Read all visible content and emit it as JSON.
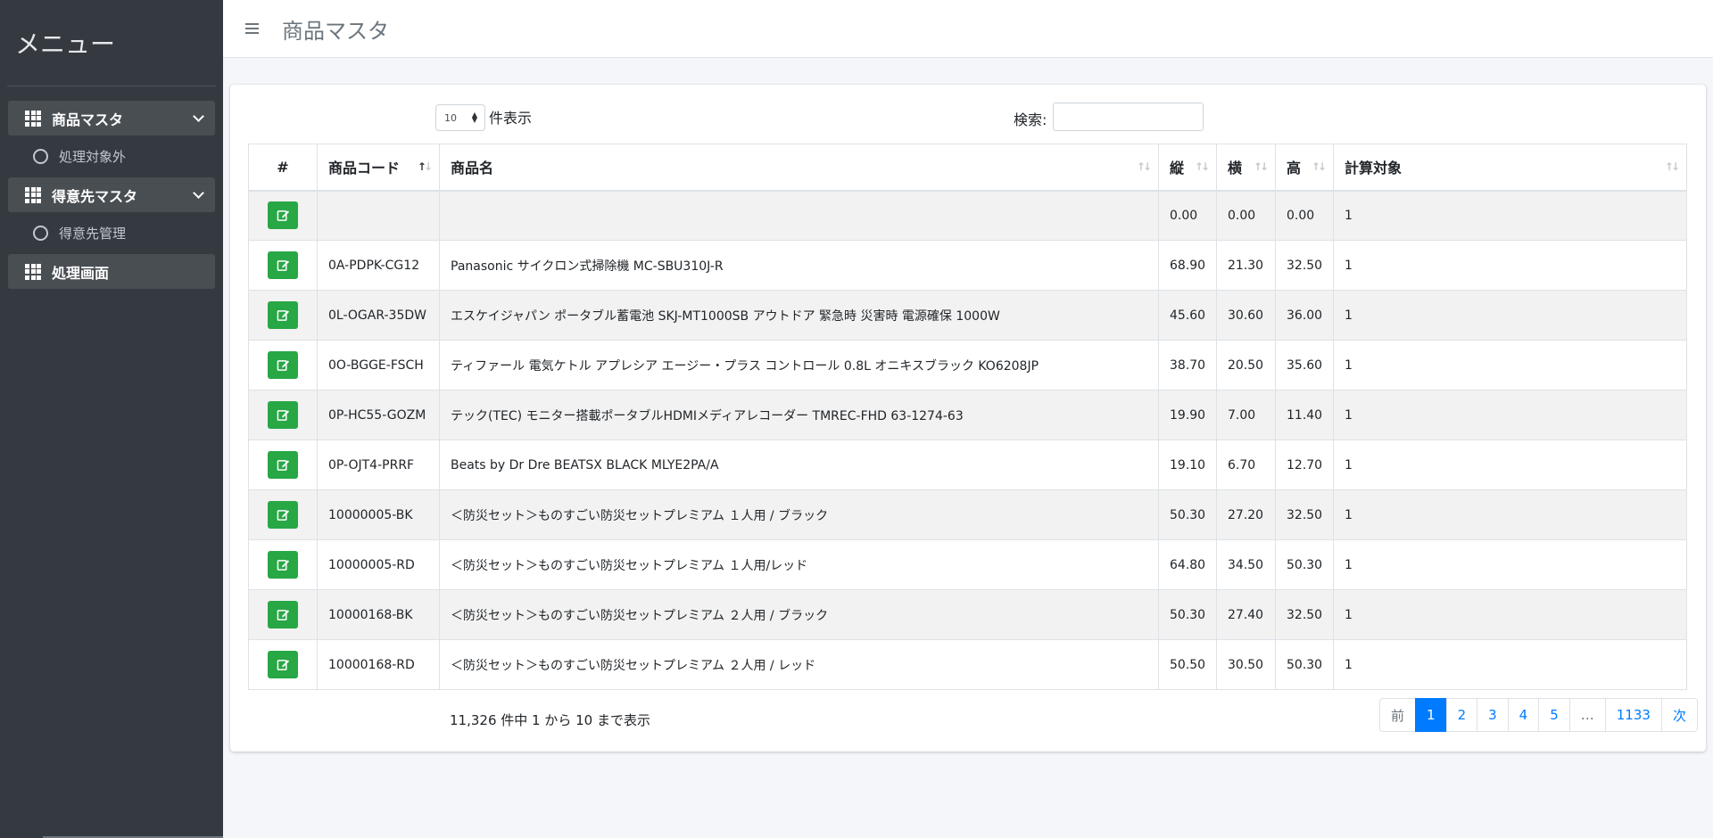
{
  "sidebar": {
    "brand": "メニュー",
    "items": [
      {
        "label": "商品マスタ",
        "type": "group"
      },
      {
        "label": "処理対象外",
        "type": "sub"
      },
      {
        "label": "得意先マスタ",
        "type": "group"
      },
      {
        "label": "得意先管理",
        "type": "sub"
      },
      {
        "label": "処理画面",
        "type": "group"
      }
    ]
  },
  "header": {
    "title": "商品マスタ",
    "menu_icon": "hamburger-icon"
  },
  "controls": {
    "length_value": "10",
    "length_label": "件表示",
    "search_label": "検索:",
    "search_value": ""
  },
  "table": {
    "columns": [
      "#",
      "商品コード",
      "商品名",
      "縦",
      "横",
      "高",
      "計算対象"
    ],
    "rows": [
      {
        "code": "",
        "name": "",
        "h": "0.00",
        "w": "0.00",
        "d": "0.00",
        "calc": "1"
      },
      {
        "code": "0A-PDPK-CG12",
        "name": "Panasonic サイクロン式掃除機 MC-SBU310J-R",
        "h": "68.90",
        "w": "21.30",
        "d": "32.50",
        "calc": "1"
      },
      {
        "code": "0L-OGAR-35DW",
        "name": "エスケイジャパン ポータブル蓄電池 SKJ-MT1000SB アウトドア 緊急時 災害時 電源確保 1000W",
        "h": "45.60",
        "w": "30.60",
        "d": "36.00",
        "calc": "1"
      },
      {
        "code": "0O-BGGE-FSCH",
        "name": "ティファール 電気ケトル アプレシア エージー・プラス コントロール 0.8L オニキスブラック KO6208JP",
        "h": "38.70",
        "w": "20.50",
        "d": "35.60",
        "calc": "1"
      },
      {
        "code": "0P-HC55-GOZM",
        "name": "テック(TEC) モニター搭載ポータブルHDMIメディアレコーダー TMREC-FHD 63-1274-63",
        "h": "19.90",
        "w": "7.00",
        "d": "11.40",
        "calc": "1"
      },
      {
        "code": "0P-OJT4-PRRF",
        "name": "Beats by Dr Dre BEATSX BLACK MLYE2PA/A",
        "h": "19.10",
        "w": "6.70",
        "d": "12.70",
        "calc": "1"
      },
      {
        "code": "10000005-BK",
        "name": "＜防災セット＞ものすごい防災セットプレミアム １人用 / ブラック",
        "h": "50.30",
        "w": "27.20",
        "d": "32.50",
        "calc": "1"
      },
      {
        "code": "10000005-RD",
        "name": "＜防災セット＞ものすごい防災セットプレミアム １人用/レッド",
        "h": "64.80",
        "w": "34.50",
        "d": "50.30",
        "calc": "1"
      },
      {
        "code": "10000168-BK",
        "name": "＜防災セット＞ものすごい防災セットプレミアム ２人用 / ブラック",
        "h": "50.30",
        "w": "27.40",
        "d": "32.50",
        "calc": "1"
      },
      {
        "code": "10000168-RD",
        "name": "＜防災セット＞ものすごい防災セットプレミアム ２人用 / レッド",
        "h": "50.50",
        "w": "30.50",
        "d": "50.30",
        "calc": "1"
      }
    ]
  },
  "footer": {
    "info": "11,326 件中 1 から 10 まで表示",
    "pages": [
      "前",
      "1",
      "2",
      "3",
      "4",
      "5",
      "…",
      "1133",
      "次"
    ],
    "active_page": "1"
  },
  "colors": {
    "sidebar": "#343a40",
    "edit_button": "#28a745",
    "primary": "#007bff"
  }
}
